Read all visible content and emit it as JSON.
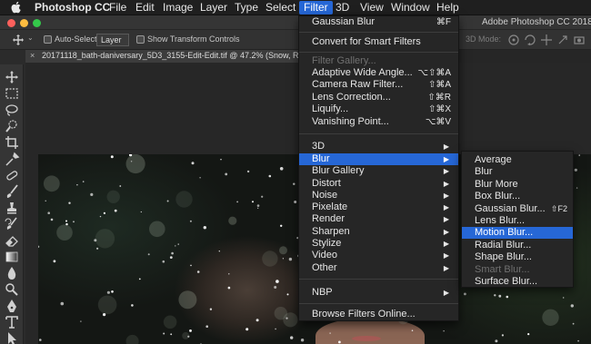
{
  "menubar": {
    "app_name": "Photoshop CC",
    "items": [
      "File",
      "Edit",
      "Image",
      "Layer",
      "Type",
      "Select",
      "Filter",
      "3D",
      "View",
      "Window",
      "Help"
    ],
    "active": "Filter"
  },
  "titlebar": {
    "title": "Adobe Photoshop CC 2018"
  },
  "options": {
    "auto_select_label": "Auto-Select:",
    "auto_select_value": "Layer",
    "show_transform_label": "Show Transform Controls",
    "mode_label": "3D Mode:"
  },
  "document": {
    "tab_title": "20171118_bath-daniversary_5D3_3155-Edit-Edit.tif @ 47.2% (Snow, R"
  },
  "filter_menu": {
    "last_filter": {
      "label": "Gaussian Blur",
      "shortcut": "⌘F"
    },
    "convert": "Convert for Smart Filters",
    "filter_gallery": "Filter Gallery...",
    "adaptive_wide": {
      "label": "Adaptive Wide Angle...",
      "shortcut": "⌥⇧⌘A"
    },
    "camera_raw": {
      "label": "Camera Raw Filter...",
      "shortcut": "⇧⌘A"
    },
    "lens_correction": {
      "label": "Lens Correction...",
      "shortcut": "⇧⌘R"
    },
    "liquify": {
      "label": "Liquify...",
      "shortcut": "⇧⌘X"
    },
    "vanishing_point": {
      "label": "Vanishing Point...",
      "shortcut": "⌥⌘V"
    },
    "submenus": [
      "3D",
      "Blur",
      "Blur Gallery",
      "Distort",
      "Noise",
      "Pixelate",
      "Render",
      "Sharpen",
      "Stylize",
      "Video",
      "Other"
    ],
    "nbp": "NBP",
    "browse": "Browse Filters Online..."
  },
  "blur_menu": {
    "items": [
      {
        "label": "Average",
        "shortcut": ""
      },
      {
        "label": "Blur",
        "shortcut": ""
      },
      {
        "label": "Blur More",
        "shortcut": ""
      },
      {
        "label": "Box Blur...",
        "shortcut": ""
      },
      {
        "label": "Gaussian Blur...",
        "shortcut": "⇧F2"
      },
      {
        "label": "Lens Blur...",
        "shortcut": ""
      },
      {
        "label": "Motion Blur...",
        "shortcut": ""
      },
      {
        "label": "Radial Blur...",
        "shortcut": ""
      },
      {
        "label": "Shape Blur...",
        "shortcut": ""
      },
      {
        "label": "Smart Blur...",
        "shortcut": ""
      },
      {
        "label": "Surface Blur...",
        "shortcut": ""
      }
    ],
    "highlighted": "Motion Blur...",
    "disabled": "Smart Blur..."
  },
  "colors": {
    "menu_highlight": "#2667d6",
    "menu_bg": "#262626",
    "app_bg": "#2b2b2b"
  }
}
